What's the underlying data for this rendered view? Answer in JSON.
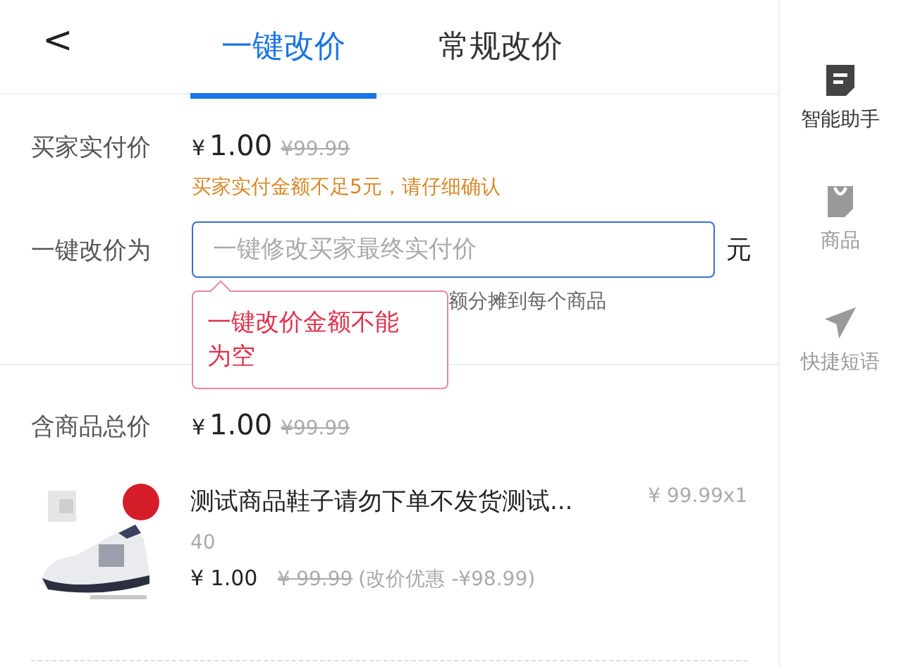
{
  "header": {
    "back": "<",
    "tabs": [
      {
        "label": "一键改价",
        "selected": true
      },
      {
        "label": "常规改价",
        "selected": false
      }
    ]
  },
  "paid": {
    "label": "买家实付价",
    "currency": "¥",
    "price": "1.00",
    "original": "¥99.99",
    "warning": "买家实付金额不足5元，请仔细确认"
  },
  "change": {
    "label": "一键改价为",
    "placeholder": "一键修改买家最终实付价",
    "unit": "元",
    "hint": "额分摊到每个商品",
    "error": "一键改价金额不能为空"
  },
  "total": {
    "label": "含商品总价",
    "currency": "¥",
    "price": "1.00",
    "original": "¥99.99"
  },
  "product": {
    "title": "测试商品鞋子请勿下单不发货测试...",
    "unit_price": "¥ 99.99x1",
    "title_line_2": "40",
    "price": "¥ 1.00",
    "original": "¥ 99.99",
    "discount": "(改价优惠 -¥98.99)"
  },
  "sidebar": [
    {
      "label": "智能助手",
      "selected": true
    },
    {
      "label": "商品",
      "selected": false
    },
    {
      "label": "快捷短语",
      "selected": false
    }
  ]
}
